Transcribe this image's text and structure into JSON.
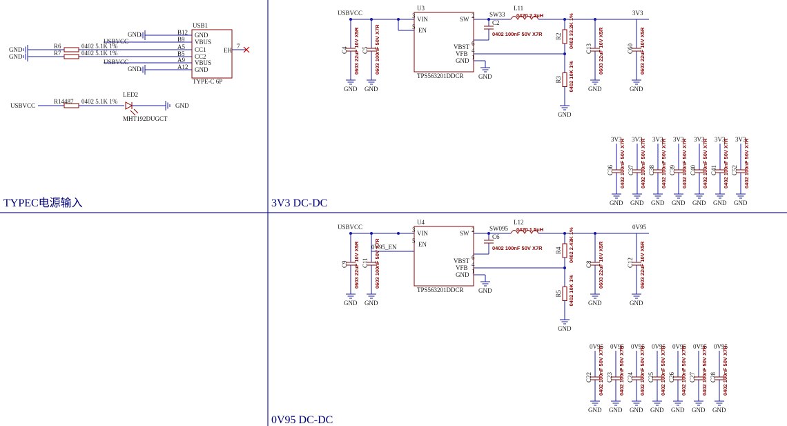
{
  "sections": {
    "typec": "TYPEC电源输入",
    "dc3v3": "3V3 DC-DC",
    "dc0v95": "0V95 DC-DC"
  },
  "usb": {
    "ref": "USB1",
    "part": "TYPE-C 6P",
    "pins": [
      {
        "num": "B12",
        "name": "GND",
        "net": "GND"
      },
      {
        "num": "B9",
        "name": "VBUS",
        "net": "USBVCC"
      },
      {
        "num": "A5",
        "name": "CC1",
        "net": ""
      },
      {
        "num": "B5",
        "name": "CC2",
        "net": ""
      },
      {
        "num": "A9",
        "name": "VBUS",
        "net": "USBVCC"
      },
      {
        "num": "A12",
        "name": "GND",
        "net": "GND"
      }
    ],
    "eh": "EH",
    "eh_pin": "7"
  },
  "resistors_cc": [
    {
      "ref": "R6",
      "value": "0402 5.1K 1%",
      "net": "GND"
    },
    {
      "ref": "R7",
      "value": "0402 5.1K 1%",
      "net": "GND"
    }
  ],
  "led_circuit": {
    "net_in": "USBVCC",
    "res_ref": "R14487",
    "res_value": "0402 5.1K 1%",
    "led_ref": "LED2",
    "led_part": "MHT192DUGCT",
    "net_out": "GND"
  },
  "reg3v3": {
    "ref": "U3",
    "part": "TPS563201DDCR",
    "input_net": "USBVCC",
    "pins": {
      "vin": "VIN",
      "en": "EN",
      "sw": "SW",
      "vbst": "VBST",
      "vfb": "VFB",
      "gnd": "GND"
    },
    "pin_nums": {
      "vin": "3",
      "en": "5",
      "sw": "2",
      "vbst": "6",
      "vfb": "4",
      "gnd": "1"
    },
    "sw_net": "SW33",
    "inductor": {
      "ref": "L11",
      "value": "0420 2.2uH"
    },
    "boot_cap": {
      "ref": "C2",
      "value": "0402 100nF 50V X7R"
    },
    "input_caps": [
      {
        "ref": "C4",
        "value": "0603 22uF 10V X5R"
      },
      {
        "ref": "C5",
        "value": "0603 100nF 50V X7R"
      }
    ],
    "fb_top": {
      "ref": "R2",
      "value": "0402 33.2K 1%"
    },
    "fb_bot": {
      "ref": "R3",
      "value": "0402 10K 1%"
    },
    "output_caps": [
      {
        "ref": "C13",
        "value": "0603 22uF 10V X5R"
      },
      {
        "ref": "C60",
        "value": "0603 22uF 10V X5R"
      }
    ],
    "output_net": "3V3"
  },
  "decoup3v3": {
    "net": "3V3",
    "value": "0402 100nF 50V X7R",
    "refs": [
      "C36",
      "C37",
      "C38",
      "C39",
      "C40",
      "C41",
      "C52"
    ]
  },
  "reg0v95": {
    "ref": "U4",
    "part": "TPS563201DDCR",
    "input_net": "USBVCC",
    "en_net": "0V95_EN",
    "pins": {
      "vin": "VIN",
      "en": "EN",
      "sw": "SW",
      "vbst": "VBST",
      "vfb": "VFB",
      "gnd": "GND"
    },
    "pin_nums": {
      "vin": "3",
      "en": "5",
      "sw": "2",
      "vbst": "6",
      "vfb": "4",
      "gnd": "1"
    },
    "sw_net": "SW095",
    "inductor": {
      "ref": "L12",
      "value": "0420 1.5uH"
    },
    "boot_cap": {
      "ref": "C6",
      "value": "0402 100nF 50V X7R"
    },
    "input_caps": [
      {
        "ref": "C9",
        "value": "0603 22uF 10V X5R"
      },
      {
        "ref": "C11",
        "value": "0603 100nF 50V X7R"
      }
    ],
    "fb_top": {
      "ref": "R4",
      "value": "0402 2.43K 1%"
    },
    "fb_bot": {
      "ref": "R5",
      "value": "0402 10K 1%"
    },
    "output_caps": [
      {
        "ref": "C8",
        "value": "0603 22uF 10V X5R"
      },
      {
        "ref": "C12",
        "value": "0603 22uF 10V X5R"
      }
    ],
    "output_net": "0V95"
  },
  "decoup0v95": {
    "net": "0V95",
    "value": "0402 100nF 50V X7R",
    "refs": [
      "C22",
      "C23",
      "C24",
      "C25",
      "C26",
      "C27",
      "C28"
    ]
  },
  "gnd_label": "GND",
  "colors": {
    "wire": "#1a1aa0",
    "component": "#8b0000",
    "net": "#1a1a1a",
    "title": "#00007a",
    "noconnect": "#cc0000"
  }
}
